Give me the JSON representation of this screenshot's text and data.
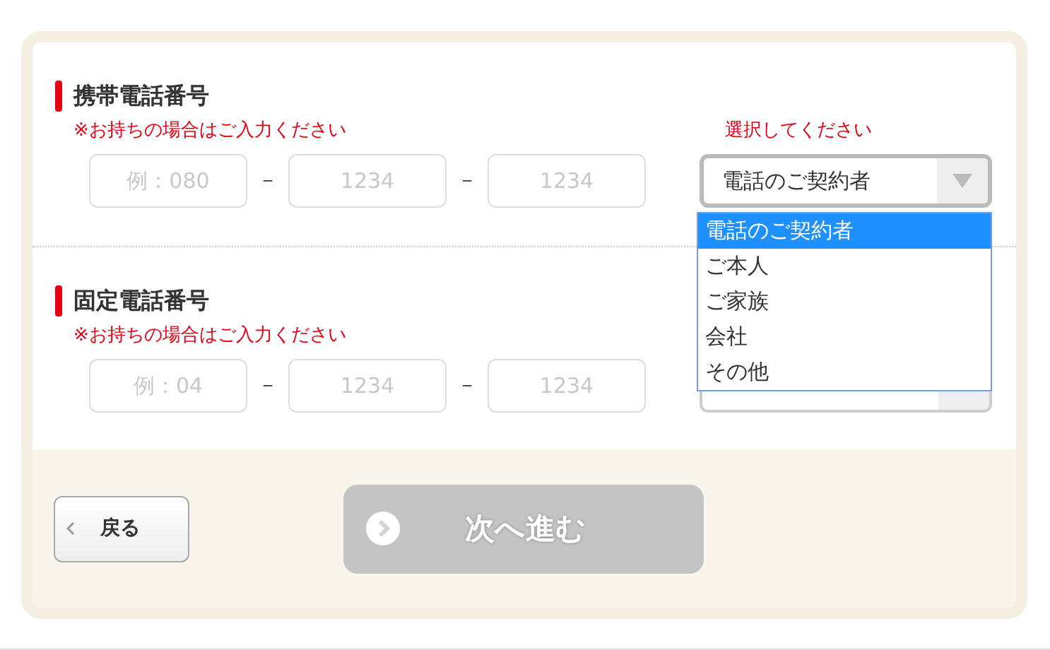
{
  "sections": [
    {
      "title": "携帯電話番号",
      "note": "※お持ちの場合はご入力ください",
      "select_hint": "選択してください",
      "fields": [
        {
          "placeholder": "例：080"
        },
        {
          "placeholder": "1234"
        },
        {
          "placeholder": "1234"
        }
      ],
      "separators": [
        "－",
        "－"
      ],
      "select": {
        "value": "電話のご契約者",
        "open": true
      }
    },
    {
      "title": "固定電話番号",
      "note": "※お持ちの場合はご入力ください",
      "fields": [
        {
          "placeholder": "例：04"
        },
        {
          "placeholder": "1234"
        },
        {
          "placeholder": "1234"
        }
      ],
      "separators": [
        "－",
        "－"
      ],
      "select": {
        "open": false
      }
    }
  ],
  "dropdown": {
    "options": [
      {
        "label": "電話のご契約者",
        "selected": true
      },
      {
        "label": "ご本人",
        "selected": false
      },
      {
        "label": "ご家族",
        "selected": false
      },
      {
        "label": "会社",
        "selected": false
      },
      {
        "label": "その他",
        "selected": false
      }
    ]
  },
  "back_button": "戻る",
  "next_button": {
    "label": "次へ進む",
    "disabled": true
  }
}
